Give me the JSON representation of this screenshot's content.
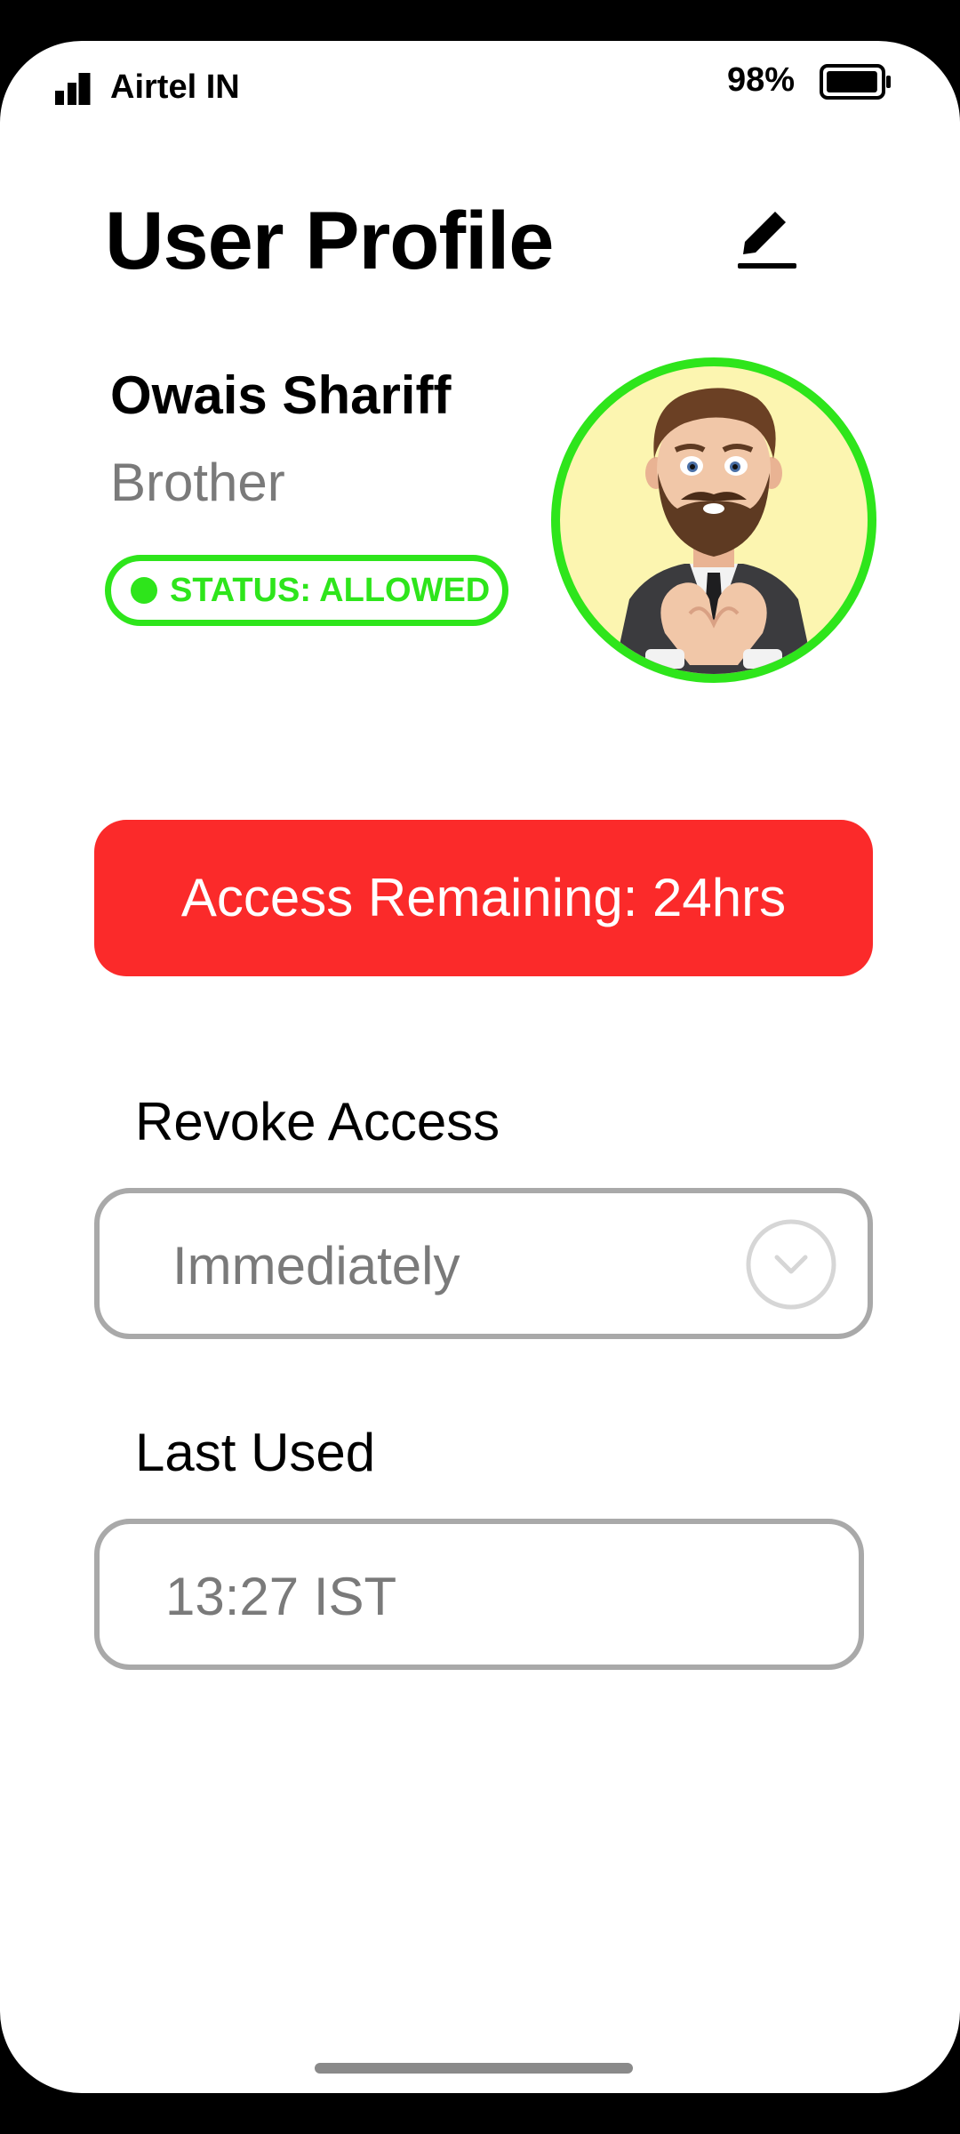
{
  "status_bar": {
    "carrier": "Airtel IN",
    "battery_percent": "98%",
    "battery_level": 0.98,
    "signal_icon": "signal-bars-icon",
    "battery_icon": "battery-icon"
  },
  "header": {
    "title": "User Profile",
    "edit_icon": "pencil-icon"
  },
  "profile": {
    "name": "Owais Shariff",
    "relation": "Brother",
    "status": "STATUS: ALLOWED",
    "status_color": "#2ee51b",
    "avatar_icon": "memoji-avatar"
  },
  "access": {
    "remaining_text": "Access Remaining: 24hrs",
    "banner_color": "#fb2a2a"
  },
  "revoke": {
    "label": "Revoke Access",
    "selected": "Immediately",
    "dropdown_icon": "chevron-down-icon"
  },
  "last_used": {
    "label": "Last Used",
    "value": "13:27 IST"
  }
}
